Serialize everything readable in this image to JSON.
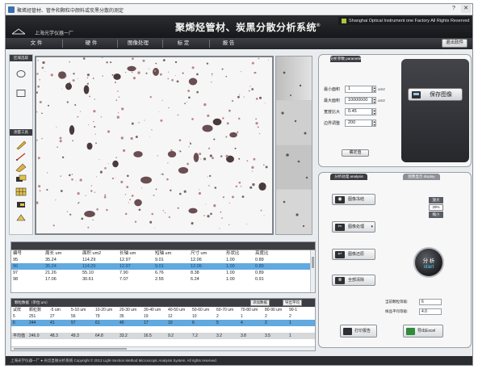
{
  "window": {
    "title": "聚烯烃管材、管件和颗粒中颜料或炭黑分散的测定",
    "buttons": {
      "help": "?",
      "close": "✕"
    }
  },
  "header": {
    "company": "上海光学仪器一厂",
    "system_title": "聚烯烃管材、炭黑分散分析系统",
    "registered_mark": "®",
    "factory": "Shanghai Optical Instrument one Factory All Rights Reserved",
    "logo_icon": "logo-mark"
  },
  "menu": {
    "items": [
      "文 件",
      "硬 件",
      "图像处理",
      "标 定",
      "报 告"
    ],
    "exit": "退出软件"
  },
  "toolbar": {
    "header_1": "区域选取",
    "header_2": "测量工具",
    "tools": [
      "ellipse-icon",
      "rectangle-icon",
      "pencil-icon",
      "line-icon",
      "ruler-icon",
      "layer-icon",
      "grid-icon",
      "eraser-icon",
      "fill-icon"
    ]
  },
  "param_panel": {
    "tab": "分析参数 parameter",
    "rows": [
      {
        "label": "最小面积",
        "value": "1",
        "unit": "um2"
      },
      {
        "label": "最大面积",
        "value": "10000000",
        "unit": "um2"
      },
      {
        "label": "宽度比大",
        "value": "0.45",
        "unit": ""
      },
      {
        "label": "边界调整",
        "value": "200",
        "unit": ""
      }
    ],
    "confirm": "确定值",
    "save_image": "保存图像"
  },
  "analysis_panel": {
    "tab_left": "分析处理 analysis",
    "tab_right": "图像显示 display",
    "buttons": [
      "图像冻结",
      "图像处理",
      "图像还原",
      "全部清除"
    ],
    "display": {
      "up": "放大",
      "center": "29%",
      "down": "缩小"
    },
    "start_cn": "分 析",
    "start_en": "start",
    "stats": [
      {
        "label": "当前颗粒等级:",
        "value": "6"
      },
      {
        "label": "样品平均等级:",
        "value": "4.0"
      }
    ],
    "print_report": "打印报告",
    "export_excel": "导出Excel"
  },
  "results_table": {
    "headers": [
      "编号",
      "周长 um",
      "面积 um2",
      "长轴 um",
      "短轴 um",
      "尺寸 um",
      "形状比",
      "亮度比"
    ],
    "rows": [
      [
        "95",
        "35.24",
        "114.29",
        "12.97",
        "9.01",
        "12.06",
        "1.00",
        "0.89"
      ],
      [
        "96",
        "35.24",
        "114.29",
        "12.97",
        "9.01",
        "12.06",
        "1.00",
        "0.89"
      ],
      [
        "97",
        "21.26",
        "55.10",
        "7.90",
        "6.76",
        "8.38",
        "1.00",
        "0.89"
      ],
      [
        "98",
        "17.06",
        "30.61",
        "7.07",
        "2.55",
        "6.24",
        "1.00",
        "0.91"
      ]
    ]
  },
  "distribution": {
    "title": "颗粒数据（单位:um）",
    "add_button": "添加数据",
    "export_button": "导出平均",
    "headers": [
      "试样",
      "颗粒数",
      "-5 um",
      "5-10 um",
      "10-20 um",
      "20-30 um",
      "30-40 um",
      "40-50 um",
      "50-60 um",
      "60-70 um",
      "70-80 um",
      "80-90 um",
      "90-1"
    ],
    "rows": [
      [
        "5",
        "251",
        "27",
        "56",
        "79",
        "35",
        "19",
        "12",
        "10",
        "2",
        "1",
        "2",
        "2"
      ],
      [
        "6",
        "244",
        "41",
        "57",
        "61",
        "40",
        "17",
        "10",
        "6",
        "5",
        "4",
        "2",
        "1"
      ]
    ],
    "average": [
      "平均值",
      "246.0",
      "48.3",
      "49.3",
      "64.8",
      "33.2",
      "16.5",
      "9.2",
      "7.2",
      "3.2",
      "3.8",
      "3.5",
      "1"
    ]
  },
  "status": {
    "text": "上海光学仪器一厂 ● 光切显微分析系统    Copyright © 2013 Light-Section Method Microscopic Analysis System. All rights reserved."
  },
  "colors": {
    "header": "#1e1f23",
    "selection": "#61a9df",
    "accent": "#4fd2f0"
  }
}
